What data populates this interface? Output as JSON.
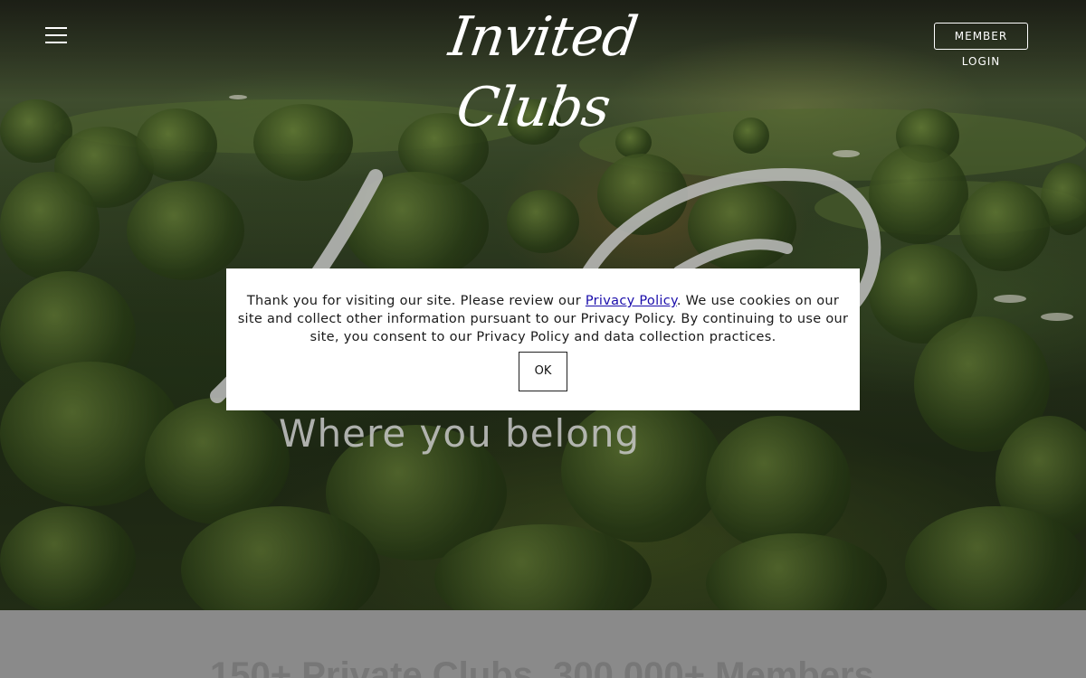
{
  "header": {
    "logo_text": "Invited Clubs",
    "login_label": "MEMBER LOGIN"
  },
  "hero": {
    "tagline": "Where you belong"
  },
  "stats": {
    "headline": "150+ Private Clubs. 300,000+ Members"
  },
  "cookie": {
    "text_before": "Thank you for visiting our site. Please review our ",
    "link_text": "Privacy Policy",
    "text_after": ". We use cookies on our site and collect other information pursuant to our Privacy Policy. By continuing to use our site, you consent to our Privacy Policy and data collection practices.",
    "ok_label": "OK"
  },
  "colors": {
    "overlay_strip": "#8a8a8a",
    "link": "#1a0dab",
    "modal_bg": "#ffffff"
  }
}
